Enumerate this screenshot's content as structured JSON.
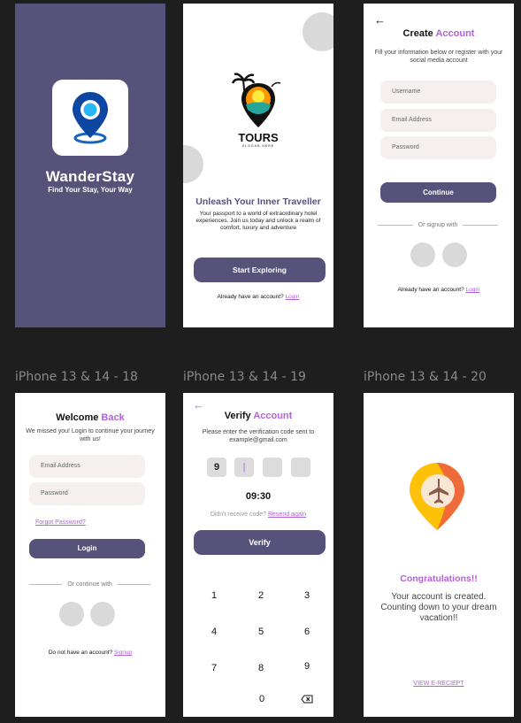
{
  "labels": {
    "frame18": "iPhone 13 & 14 - 18",
    "frame19": "iPhone 13 & 14 - 19",
    "frame20": "iPhone 13 & 14 - 20"
  },
  "colors": {
    "primary": "#575279",
    "accent": "#b062d9",
    "field": "#f5efef",
    "placeholder_circle": "#d9d9d9"
  },
  "splash": {
    "icon": "location-pin-icon",
    "app_name": "WanderStay",
    "tagline": "Find Your Stay, Your Way"
  },
  "onboarding": {
    "logo_icon": "tours-palm-pin-logo",
    "logo_text": "TOURS",
    "logo_slogan": "SLOGAN HERE",
    "title": "Unleash Your Inner Traveller",
    "description": "Your passport to a world of extraordinary hotel experiences. Join us today and unlock a realm of comfort, luxury and adventure",
    "cta": "Start Exploring",
    "have_account": "Already have an account?",
    "login_link": "Login"
  },
  "create_account": {
    "title_main": "Create",
    "title_accent": "Account",
    "description": "Fill your information below or register with your social media account",
    "username_placeholder": "Username",
    "email_placeholder": "Email Address",
    "password_placeholder": "Password",
    "continue": "Continue",
    "divider": "Or signup with",
    "have_account": "Already have an account?",
    "login_link": "Login"
  },
  "login": {
    "title_main": "Welcome",
    "title_accent": "Back",
    "description": "We missed you! Login to continue your journey with us!",
    "email_placeholder": "Email Address",
    "password_placeholder": "Password",
    "forgot": "Forgot Password?",
    "login_button": "Login",
    "divider": "Or continue with",
    "no_account": "Do not  have an account?",
    "signup_link": "Signup"
  },
  "verify": {
    "title_main": "Verify",
    "title_accent": "Account",
    "description": "Please enter the verification code sent to example@gmail.com",
    "code": [
      "9",
      "",
      "",
      ""
    ],
    "timer": "09:30",
    "resend_prompt": "Didn't receive code?",
    "resend_link": "Resend again",
    "verify_button": "Verify",
    "keypad": [
      "1",
      "2",
      "3",
      "4",
      "5",
      "6",
      "7",
      "8",
      "9",
      "0"
    ]
  },
  "congrats": {
    "icon": "airplane-pin-icon",
    "title": "Congratulations!!",
    "message": "Your account is created. Counting down to your dream vacation!!",
    "receipt_link": "VIEW E-RECIEPT"
  }
}
